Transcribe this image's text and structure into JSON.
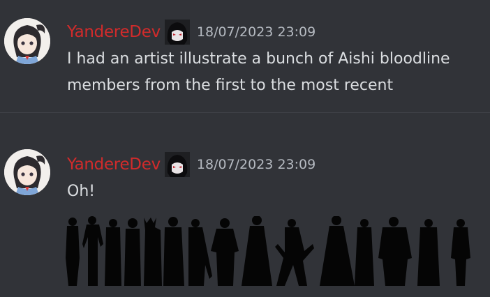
{
  "messages": [
    {
      "author": "YandereDev",
      "author_color": "#d22b2b",
      "timestamp": "18/07/2023 23:09",
      "lines": [
        "I had an artist illustrate a bunch of Aishi bloodline",
        "members from the first to the most recent"
      ],
      "avatar_icon": "anime-girl-avatar",
      "role_icon": "anime-face-icon"
    },
    {
      "author": "YandereDev",
      "author_color": "#d22b2b",
      "timestamp": "18/07/2023 23:09",
      "lines": [
        "Oh!"
      ],
      "avatar_icon": "anime-girl-avatar",
      "role_icon": "anime-face-icon",
      "attachment": "silhouettes-image"
    }
  ]
}
